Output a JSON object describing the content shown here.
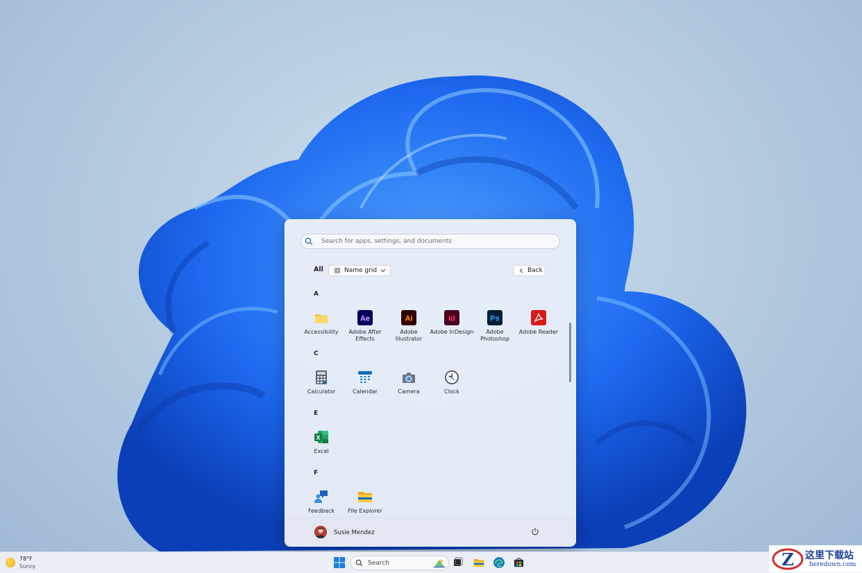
{
  "start_menu": {
    "search_placeholder": "Search for apps, settings, and documents",
    "filter_label": "All",
    "view_label": "Name grid",
    "back_label": "Back",
    "groups": [
      {
        "letter": "A",
        "apps": [
          {
            "name": "Accessibility",
            "icon": "folder-icon"
          },
          {
            "name": "Adobe After Effects",
            "icon": "after-effects-icon",
            "glyph": "Ae"
          },
          {
            "name": "Adobe Illustrator",
            "icon": "illustrator-icon",
            "glyph": "Ai"
          },
          {
            "name": "Adobe InDesign",
            "icon": "indesign-icon",
            "glyph": "Id"
          },
          {
            "name": "Adobe Photoshop",
            "icon": "photoshop-icon",
            "glyph": "Ps"
          },
          {
            "name": "Adobe Reader",
            "icon": "acrobat-reader-icon"
          }
        ]
      },
      {
        "letter": "C",
        "apps": [
          {
            "name": "Calculator",
            "icon": "calculator-icon"
          },
          {
            "name": "Calendar",
            "icon": "calendar-icon"
          },
          {
            "name": "Camera",
            "icon": "camera-icon"
          },
          {
            "name": "Clock",
            "icon": "clock-icon"
          }
        ]
      },
      {
        "letter": "E",
        "apps": [
          {
            "name": "Excel",
            "icon": "excel-icon",
            "glyph": "X"
          }
        ]
      },
      {
        "letter": "F",
        "apps": [
          {
            "name": "Feedback",
            "icon": "feedback-hub-icon"
          },
          {
            "name": "File Explorer",
            "icon": "file-explorer-icon"
          }
        ]
      }
    ],
    "user_name": "Susie Mendez"
  },
  "taskbar": {
    "weather_temp": "78°F",
    "weather_condition": "Sunny",
    "search_label": "Search"
  },
  "watermark": {
    "site_name_cn": "这里下载站",
    "site_url": "heredown.com"
  },
  "colors": {
    "accent": "#0f6cbd",
    "wallpaper_blue": "#1e6af0"
  }
}
